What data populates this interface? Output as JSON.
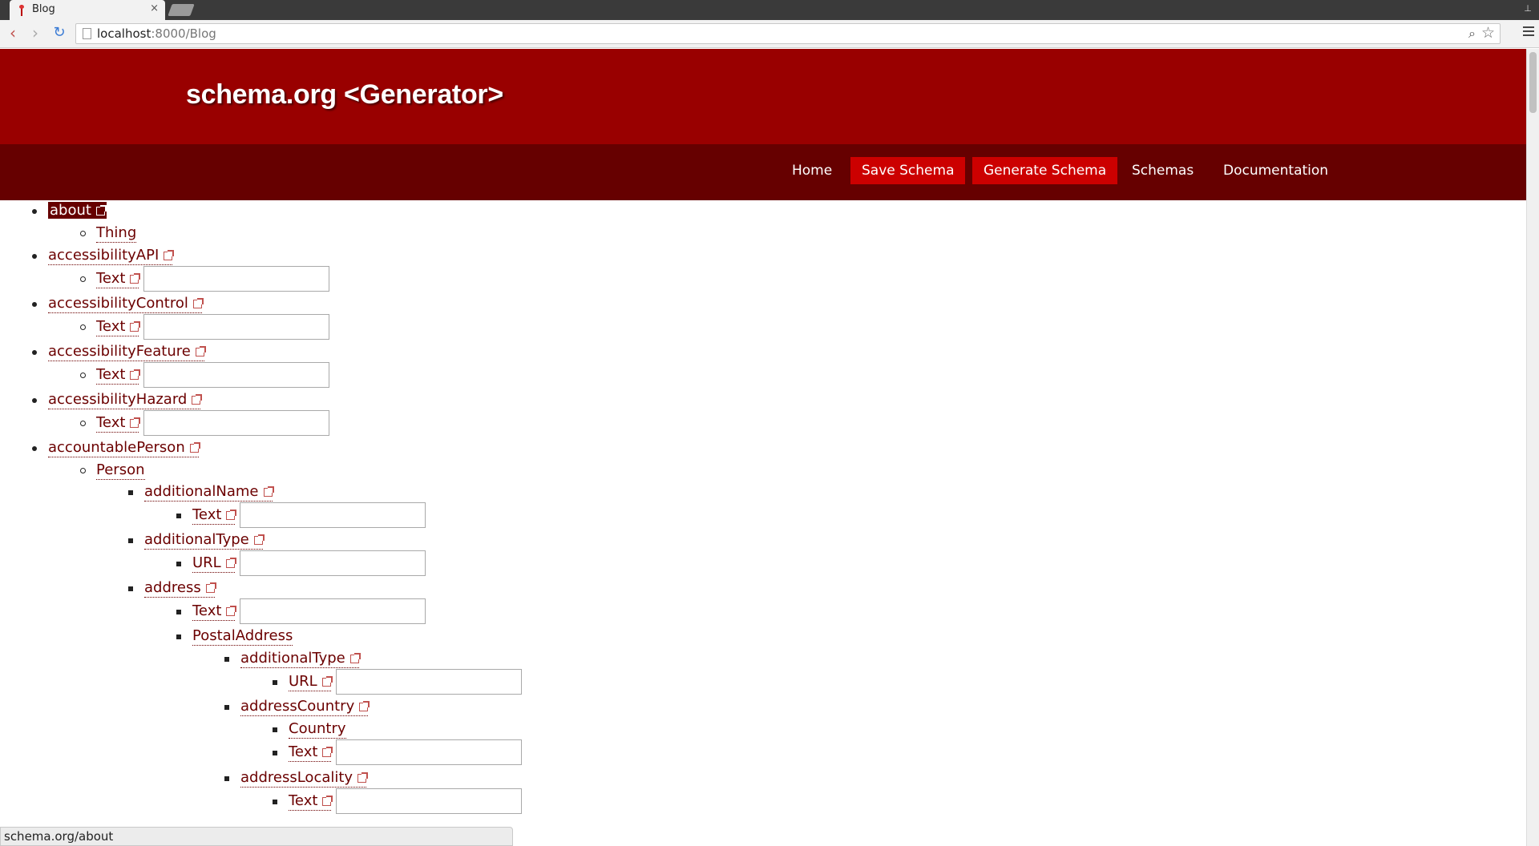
{
  "browser": {
    "tab_title": "Blog",
    "tab_close": "×",
    "url_host": "localhost",
    "url_rest": ":8000/Blog",
    "back": "‹",
    "forward": "›",
    "reload": "↻",
    "zoom_icon": "⌕",
    "star_icon": "☆",
    "user_icon": "⊥"
  },
  "site": {
    "title": "schema.org <Generator>",
    "nav": [
      {
        "label": "Home",
        "active": false
      },
      {
        "label": "Save Schema",
        "active": true
      },
      {
        "label": "Generate Schema",
        "active": true
      },
      {
        "label": "Schemas",
        "active": false
      },
      {
        "label": "Documentation",
        "active": false
      }
    ]
  },
  "tree": [
    {
      "label": "about",
      "level": 0,
      "ext": true,
      "selected": true
    },
    {
      "label": "Thing",
      "level": 1,
      "ext": false
    },
    {
      "label": "accessibilityAPI",
      "level": 0,
      "ext": true
    },
    {
      "label": "Text",
      "level": 1,
      "ext": true,
      "input": ""
    },
    {
      "label": "accessibilityControl",
      "level": 0,
      "ext": true
    },
    {
      "label": "Text",
      "level": 1,
      "ext": true,
      "input": ""
    },
    {
      "label": "accessibilityFeature",
      "level": 0,
      "ext": true
    },
    {
      "label": "Text",
      "level": 1,
      "ext": true,
      "input": ""
    },
    {
      "label": "accessibilityHazard",
      "level": 0,
      "ext": true
    },
    {
      "label": "Text",
      "level": 1,
      "ext": true,
      "input": ""
    },
    {
      "label": "accountablePerson",
      "level": 0,
      "ext": true
    },
    {
      "label": "Person",
      "level": 1,
      "ext": false
    },
    {
      "label": "additionalName",
      "level": 2,
      "ext": true
    },
    {
      "label": "Text",
      "level": 3,
      "ext": true,
      "input": ""
    },
    {
      "label": "additionalType",
      "level": 2,
      "ext": true
    },
    {
      "label": "URL",
      "level": 3,
      "ext": true,
      "input": ""
    },
    {
      "label": "address",
      "level": 2,
      "ext": true
    },
    {
      "label": "Text",
      "level": 3,
      "ext": true,
      "input": ""
    },
    {
      "label": "PostalAddress",
      "level": 3,
      "ext": false
    },
    {
      "label": "additionalType",
      "level": 4,
      "ext": true
    },
    {
      "label": "URL",
      "level": 5,
      "ext": true,
      "input": ""
    },
    {
      "label": "addressCountry",
      "level": 4,
      "ext": true
    },
    {
      "label": "Country",
      "level": 5,
      "ext": false
    },
    {
      "label": "Text",
      "level": 5,
      "ext": true,
      "input": ""
    },
    {
      "label": "addressLocality",
      "level": 4,
      "ext": true
    },
    {
      "label": "Text",
      "level": 5,
      "ext": true,
      "input": ""
    }
  ],
  "status_bar": "schema.org/about"
}
